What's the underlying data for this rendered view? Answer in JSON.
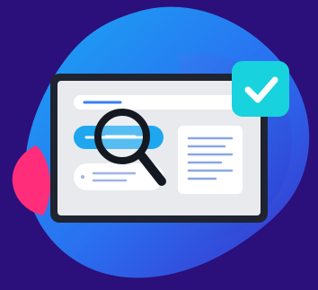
{
  "illustration": {
    "subject": "browser-window-search-verified",
    "icons": [
      "magnifier-icon",
      "checkmark-icon"
    ],
    "colors": {
      "background": "#2b0f7a",
      "blob_dark": "#2d5be0",
      "blob_light": "#1a9af2",
      "accent_pink": "#ff2d7a",
      "window_frame": "#1f2430",
      "window_body": "#e9ebef",
      "highlight_pill": "#1ea7ee",
      "check_badge": "#18d3dd"
    }
  }
}
